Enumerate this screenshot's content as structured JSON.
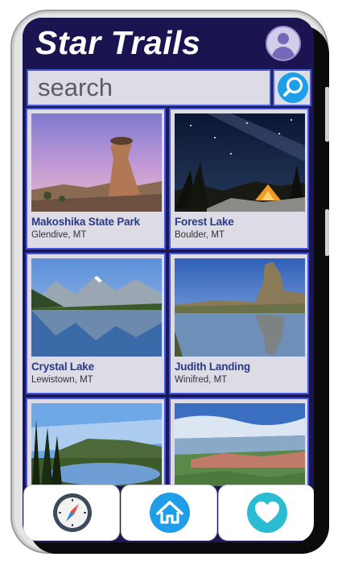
{
  "app": {
    "title": "Star Trails"
  },
  "search": {
    "placeholder": "search"
  },
  "colors": {
    "header": "#1a1450",
    "accent": "#1e9ee8",
    "card_border": "#3f57e0",
    "heart": "#2bbbd2"
  },
  "places": [
    {
      "name": "Makoshika State Park",
      "location": "Glendive, MT"
    },
    {
      "name": "Forest Lake",
      "location": "Boulder, MT"
    },
    {
      "name": "Crystal Lake",
      "location": "Lewistown, MT"
    },
    {
      "name": "Judith Landing",
      "location": "Winifred, MT"
    },
    {
      "name": "",
      "location": ""
    },
    {
      "name": "",
      "location": ""
    }
  ],
  "nav": [
    {
      "icon": "compass-icon"
    },
    {
      "icon": "home-icon"
    },
    {
      "icon": "heart-icon"
    }
  ]
}
